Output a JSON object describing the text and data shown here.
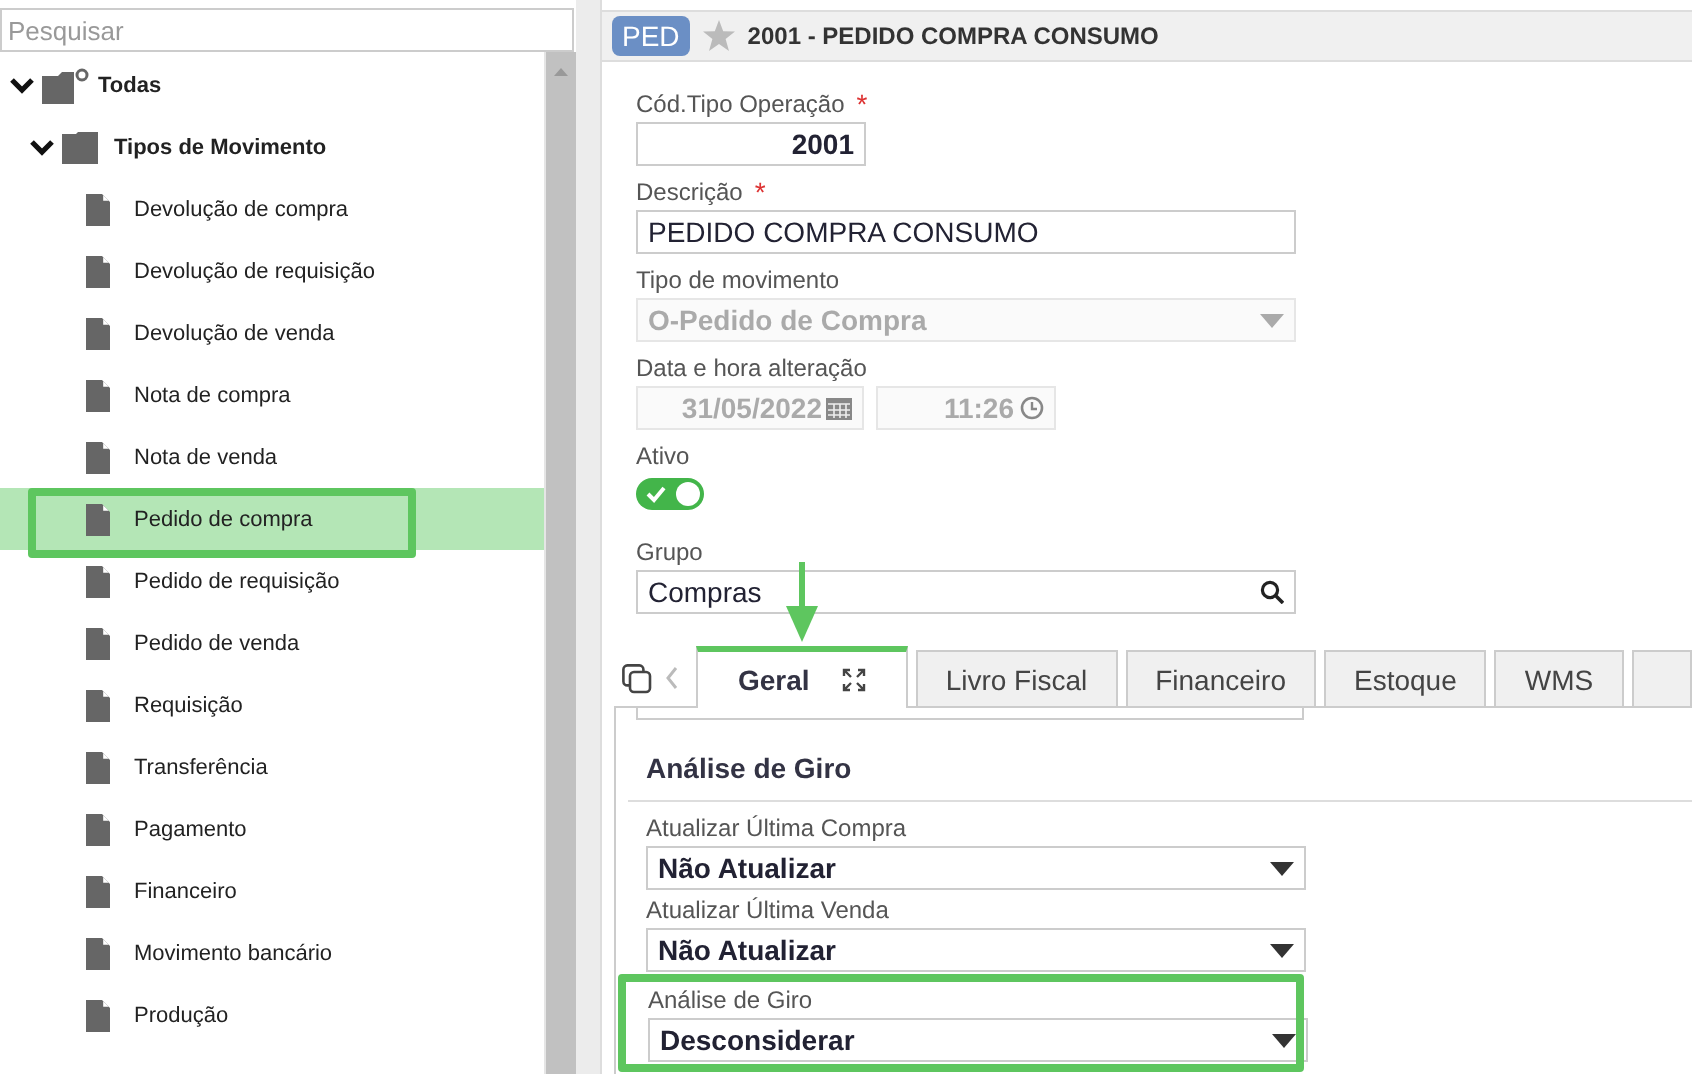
{
  "sidebar": {
    "search": {
      "placeholder": "Pesquisar"
    },
    "tree": [
      {
        "label": "Todas",
        "kind": "root",
        "expanded": true,
        "children": [
          {
            "label": "Tipos de Movimento",
            "kind": "folder",
            "expanded": true,
            "children": [
              {
                "label": "Devolução de compra",
                "kind": "doc",
                "selected": false,
                "highlighted": false
              },
              {
                "label": "Devolução de requisição",
                "kind": "doc",
                "selected": false,
                "highlighted": false
              },
              {
                "label": "Devolução de venda",
                "kind": "doc",
                "selected": false,
                "highlighted": false
              },
              {
                "label": "Nota de compra",
                "kind": "doc",
                "selected": false,
                "highlighted": false
              },
              {
                "label": "Nota de venda",
                "kind": "doc",
                "selected": false,
                "highlighted": false
              },
              {
                "label": "Pedido de compra",
                "kind": "doc",
                "selected": true,
                "highlighted": true
              },
              {
                "label": "Pedido de requisição",
                "kind": "doc",
                "selected": false,
                "highlighted": false
              },
              {
                "label": "Pedido de venda",
                "kind": "doc",
                "selected": false,
                "highlighted": false
              },
              {
                "label": "Requisição",
                "kind": "doc",
                "selected": false,
                "highlighted": false
              },
              {
                "label": "Transferência",
                "kind": "doc",
                "selected": false,
                "highlighted": false
              },
              {
                "label": "Pagamento",
                "kind": "doc",
                "selected": false,
                "highlighted": false
              },
              {
                "label": "Financeiro",
                "kind": "doc",
                "selected": false,
                "highlighted": false
              },
              {
                "label": "Movimento bancário",
                "kind": "doc",
                "selected": false,
                "highlighted": false
              },
              {
                "label": "Produção",
                "kind": "doc",
                "selected": false,
                "highlighted": false
              }
            ]
          }
        ]
      }
    ]
  },
  "header": {
    "badge": "PED",
    "starred": false,
    "title": "2001 - PEDIDO COMPRA CONSUMO"
  },
  "form": [
    {
      "kind": "code",
      "label": "Cód.Tipo Operação",
      "required_mark": "*",
      "value": "2001"
    },
    {
      "kind": "text",
      "label": "Descrição",
      "required_mark": "*",
      "value": "PEDIDO COMPRA CONSUMO"
    },
    {
      "kind": "select",
      "label": "Tipo de movimento",
      "disabled": true,
      "value": "O-Pedido de Compra"
    },
    {
      "kind": "datetime",
      "label": "Data e hora alteração",
      "date": "31/05/2022",
      "time": "11:26"
    },
    {
      "kind": "toggle",
      "label": "Ativo",
      "on": true
    },
    {
      "kind": "lookup",
      "label": "Grupo",
      "value": "Compras"
    }
  ],
  "tabs": [
    {
      "label": "Geral",
      "selected": true,
      "marked": true
    },
    {
      "label": "Livro Fiscal",
      "selected": false,
      "marked": false
    },
    {
      "label": "Financeiro",
      "selected": false,
      "marked": false
    },
    {
      "label": "Estoque",
      "selected": false,
      "marked": false
    },
    {
      "label": "WMS",
      "selected": false,
      "marked": false
    }
  ],
  "section": {
    "title": "Análise de Giro",
    "fields": [
      {
        "label": "Atualizar Última Compra",
        "value": "Não Atualizar",
        "highlighted": false
      },
      {
        "label": "Atualizar Última Venda",
        "value": "Não Atualizar",
        "highlighted": false
      },
      {
        "label": "Análise de Giro",
        "value": "Desconsiderar",
        "highlighted": true
      }
    ]
  }
}
